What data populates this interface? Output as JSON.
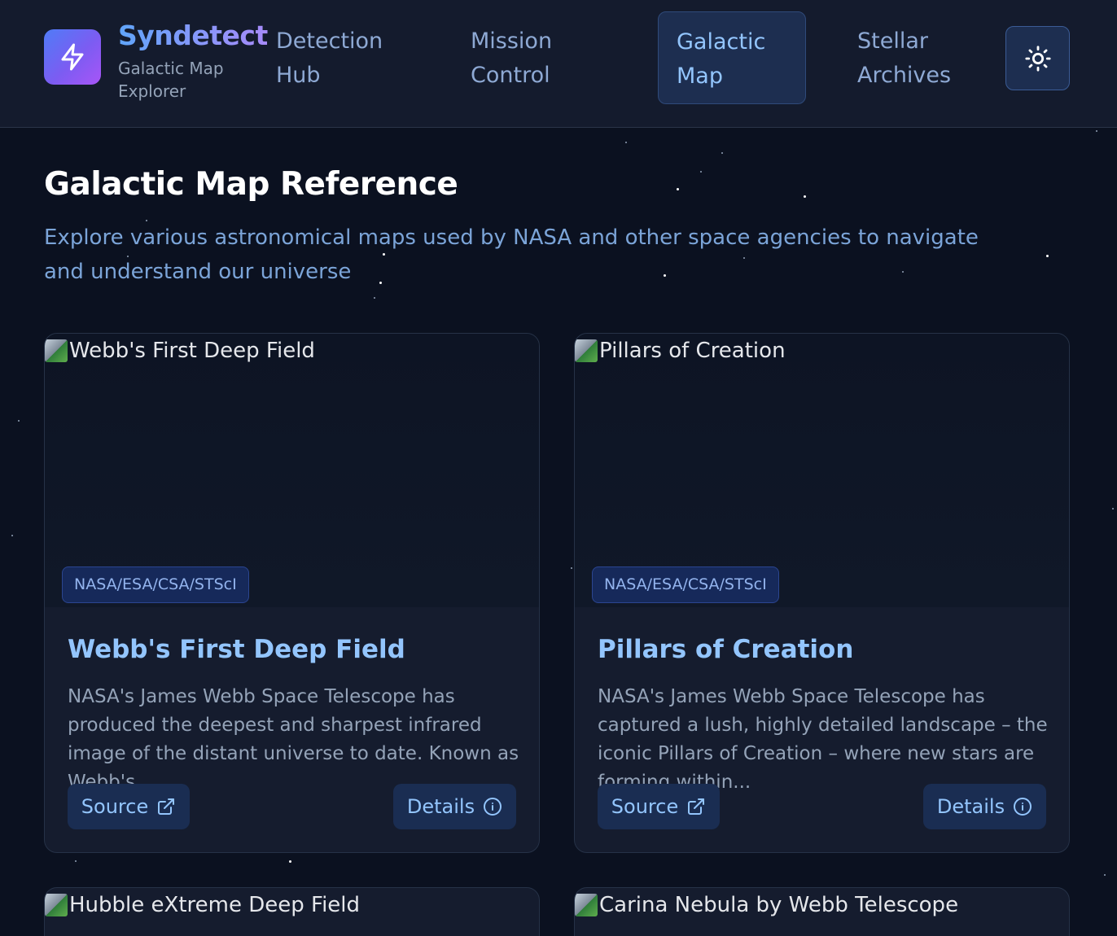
{
  "brand": {
    "name": "Syndetect",
    "subtitle": "Galactic Map Explorer",
    "logo_icon": "lightning-bolt-icon"
  },
  "nav": {
    "items": [
      {
        "label": "Detection Hub",
        "active": false
      },
      {
        "label": "Mission Control",
        "active": false
      },
      {
        "label": "Galactic Map",
        "active": true
      },
      {
        "label": "Stellar Archives",
        "active": false
      }
    ],
    "theme_toggle_icon": "sun-icon"
  },
  "page": {
    "title": "Galactic Map Reference",
    "subtitle": "Explore various astronomical maps used by NASA and other space agencies to navigate and understand our universe"
  },
  "cards": [
    {
      "image_alt": "Webb's First Deep Field",
      "credit": "NASA/ESA/CSA/STScI",
      "title": "Webb's First Deep Field",
      "description": "NASA's James Webb Space Telescope has produced the deepest and sharpest infrared image of the distant universe to date. Known as Webb's...",
      "source_label": "Source",
      "details_label": "Details"
    },
    {
      "image_alt": "Pillars of Creation",
      "credit": "NASA/ESA/CSA/STScI",
      "title": "Pillars of Creation",
      "description": "NASA's James Webb Space Telescope has captured a lush, highly detailed landscape – the iconic Pillars of Creation – where new stars are forming within...",
      "source_label": "Source",
      "details_label": "Details"
    },
    {
      "image_alt": "Hubble eXtreme Deep Field"
    },
    {
      "image_alt": "Carina Nebula by Webb Telescope"
    }
  ],
  "colors": {
    "background": "#0b1120",
    "header": "#141b2d",
    "accent": "#93c5fd",
    "brand_gradient_start": "#60a5fa",
    "brand_gradient_end": "#a78bfa"
  }
}
